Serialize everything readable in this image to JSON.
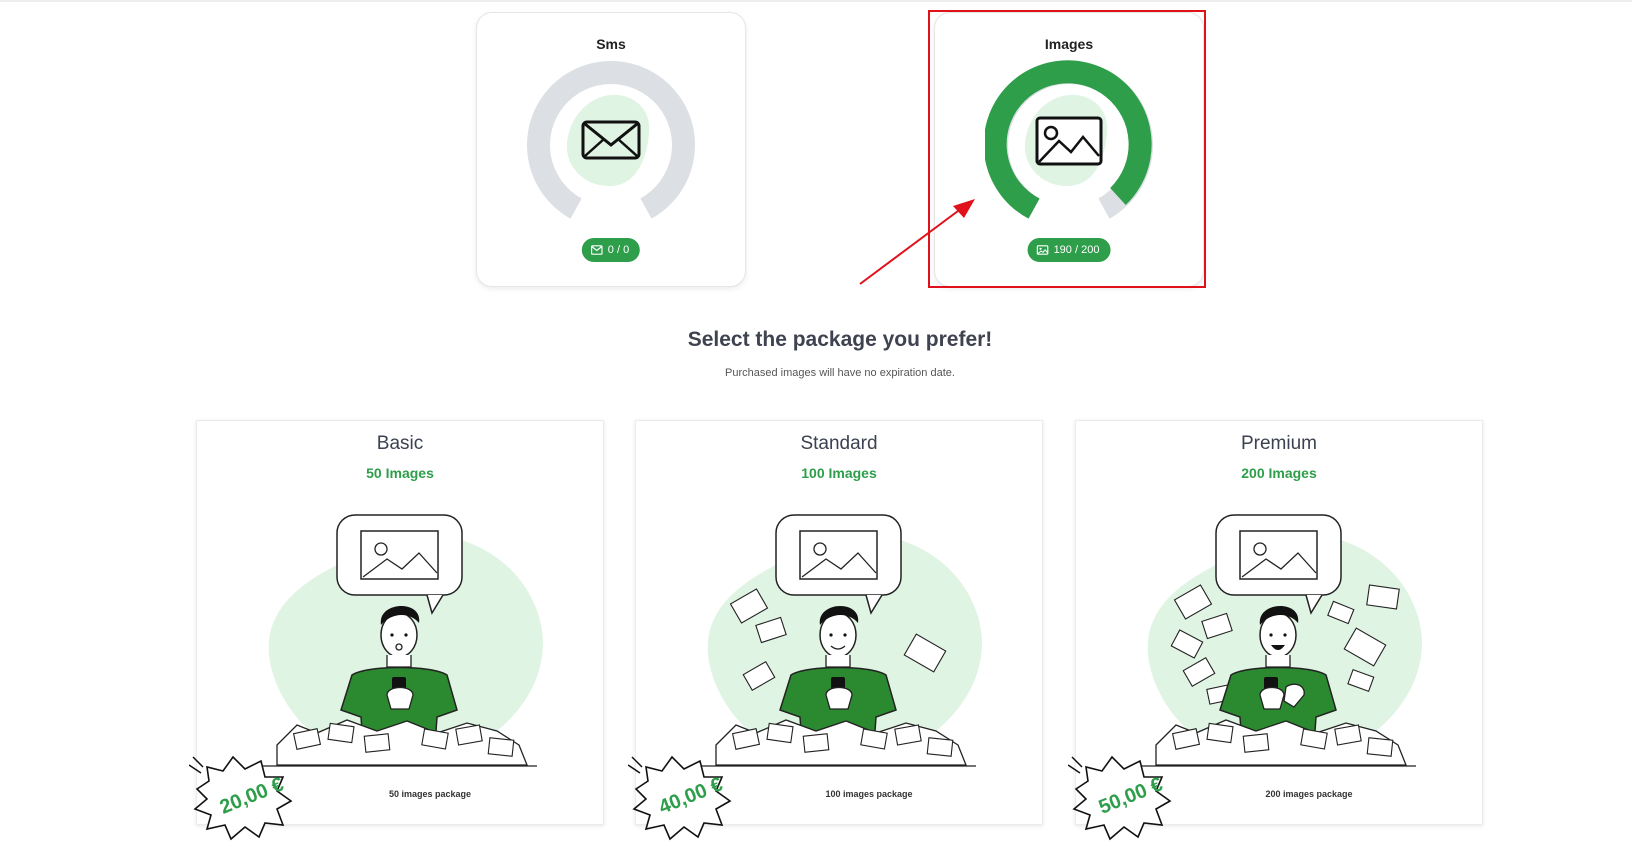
{
  "usage": {
    "sms": {
      "title": "Sms",
      "used": 0,
      "total": 0,
      "label": "0 / 0",
      "progress": 0.0
    },
    "images": {
      "title": "Images",
      "used": 190,
      "total": 200,
      "label": "190 / 200",
      "progress": 0.95
    }
  },
  "headline": "Select the package you prefer!",
  "subline": "Purchased images will have no expiration date.",
  "packages": [
    {
      "name": "Basic",
      "count": "50 Images",
      "price": "20,00 €",
      "description": "50 images package"
    },
    {
      "name": "Standard",
      "count": "100 Images",
      "price": "40,00 €",
      "description": "100 images package"
    },
    {
      "name": "Premium",
      "count": "200 Images",
      "price": "50,00 €",
      "description": "200 images package"
    }
  ],
  "colors": {
    "accent": "#2e9e4a",
    "gauge_track": "#dcdfe4",
    "blob": "#dff4e2",
    "highlight": "#e0111a"
  },
  "icons": {
    "sms": "envelope-icon",
    "images": "image-icon",
    "annotation": "red-arrow"
  }
}
